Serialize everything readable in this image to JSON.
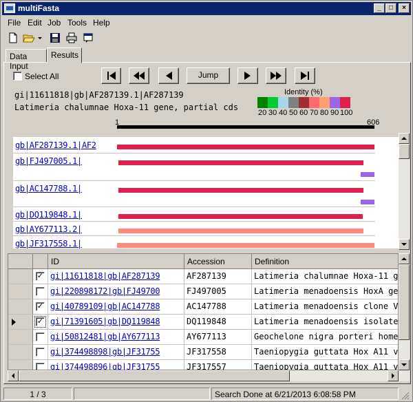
{
  "window": {
    "title": "multiFasta"
  },
  "menu": [
    "File",
    "Edit",
    "Job",
    "Tools",
    "Help"
  ],
  "toolbar_icons": [
    "new-file-icon",
    "open-folder-icon",
    "dropdown-arrow-icon",
    "save-icon",
    "print-icon",
    "window-icon"
  ],
  "tabs": [
    {
      "label": "Data Input",
      "active": false
    },
    {
      "label": "Results",
      "active": true
    }
  ],
  "results": {
    "select_all_label": "Select All",
    "jump_label": "Jump",
    "header_id": "gi|11611818|gb|AF287139.1|AF287139",
    "header_desc": "Latimeria chalumnae Hoxa-11 gene, partial cds",
    "ruler_start": "1",
    "ruler_end": "606",
    "identity_title": "Identity (%)",
    "identity_labels": [
      "20",
      "30",
      "40",
      "50",
      "60",
      "70",
      "80",
      "90",
      "100"
    ],
    "identity_colors": [
      "#008000",
      "#00cc33",
      "#a6d5ec",
      "#808080",
      "#a0302f",
      "#ff6b6b",
      "#ffa070",
      "#9966e6",
      "#e0204a"
    ]
  },
  "alignments": [
    {
      "label": "gb|AF287139.1|AF2",
      "bars": [
        {
          "start": 1,
          "end": 606,
          "color": "#e0204a"
        }
      ]
    },
    {
      "label": "gb|FJ497005.1|",
      "bars": [
        {
          "start": 5,
          "end": 580,
          "color": "#e0204a"
        },
        {
          "start": 575,
          "end": 606,
          "color": "#9966e6"
        }
      ]
    },
    {
      "label": "gb|AC147788.1|",
      "bars": [
        {
          "start": 5,
          "end": 580,
          "color": "#e0204a"
        },
        {
          "start": 575,
          "end": 606,
          "color": "#9966e6"
        }
      ]
    },
    {
      "label": "gb|DQ119848.1|",
      "bars": [
        {
          "start": 5,
          "end": 578,
          "color": "#e0204a"
        }
      ]
    },
    {
      "label": "gb|AY677113.2|",
      "bars": [
        {
          "start": 5,
          "end": 580,
          "color": "#ff8a78"
        }
      ]
    },
    {
      "label": "gb|JF317558.1|",
      "bars": [
        {
          "start": 1,
          "end": 606,
          "color": "#ff8a78"
        }
      ]
    }
  ],
  "grid": {
    "columns": [
      "ID",
      "Accession",
      "Definition"
    ],
    "rows": [
      {
        "checked": true,
        "id": "gi|11611818|gb|AF287139",
        "accession": "AF287139",
        "definition": "Latimeria chalumnae Hoxa-11 g",
        "current": false
      },
      {
        "checked": false,
        "id": "gi|220898172|gb|FJ49700",
        "accession": "FJ497005",
        "definition": "Latimeria menadoensis HoxA ge",
        "current": false
      },
      {
        "checked": true,
        "id": "gi|40789109|gb|AC147788",
        "accession": "AC147788",
        "definition": "Latimeria menadoensis clone V",
        "current": false
      },
      {
        "checked": true,
        "id": "gi|71391605|gb|DQ119848",
        "accession": "DQ119848",
        "definition": "Latimeria menadoensis isolate I",
        "current": true
      },
      {
        "checked": false,
        "id": "gi|50812481|gb|AY677113",
        "accession": "AY677113",
        "definition": "Geochelone nigra porteri homeo",
        "current": false
      },
      {
        "checked": false,
        "id": "gi|374498898|gb|JF31755",
        "accession": "JF317558",
        "definition": "Taeniopygia guttata Hox A11 v",
        "current": false
      },
      {
        "checked": false,
        "id": "gi|374498896|gb|JF31755",
        "accession": "JF317557",
        "definition": "Taeniopygia guttata Hox A11 v",
        "current": false
      }
    ]
  },
  "status": {
    "page": "1 / 3",
    "message": "Search Done at  6/21/2013 6:08:58 PM"
  }
}
